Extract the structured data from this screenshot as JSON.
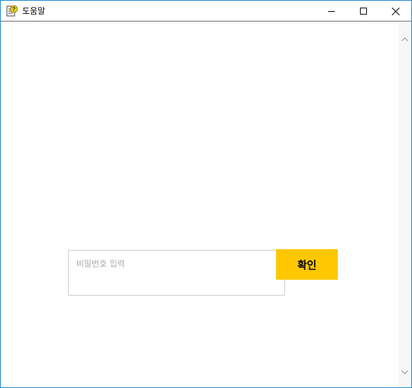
{
  "window": {
    "title": "도움말",
    "controls": {
      "minimize": "minimize-icon",
      "maximize": "maximize-icon",
      "close": "close-icon"
    }
  },
  "form": {
    "password_placeholder": "비밀번호 입력",
    "password_value": "",
    "confirm_label": "확인"
  },
  "colors": {
    "accent": "#ffc700",
    "window_border": "#1883d7",
    "input_border": "#cccccc",
    "placeholder": "#a8a8a8",
    "scrollbar_track": "#f7f7f7"
  }
}
